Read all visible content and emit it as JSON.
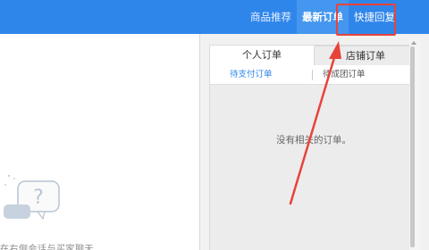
{
  "header": {
    "tabs": [
      {
        "label": "商品推荐"
      },
      {
        "label": "最新订单"
      },
      {
        "label": "快捷回复"
      }
    ]
  },
  "orders": {
    "tabs": [
      {
        "label": "个人订单"
      },
      {
        "label": "店铺订单"
      }
    ],
    "filters": [
      {
        "label": "待支付订单"
      },
      {
        "label": "待成团订单"
      }
    ],
    "empty_message": "没有相关的订单。"
  },
  "chat": {
    "hint": "在右侧会话与买家聊天"
  },
  "colors": {
    "topbar": "#2f86ea",
    "accent": "#2f86ea",
    "annotation": "#e8433a"
  }
}
